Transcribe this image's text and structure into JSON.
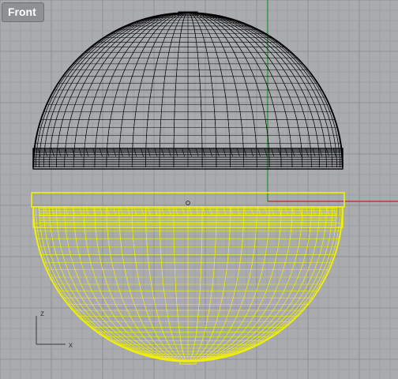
{
  "viewport": {
    "title": "Front",
    "axes": {
      "vertical_label": "z",
      "horizontal_label": "x"
    }
  },
  "colors": {
    "background": "#a9abae",
    "grid_minor": "#9d9fa2",
    "grid_major": "#8d8f92",
    "wireframe": "#000000",
    "selected_wireframe": "#f2f200",
    "world_y_axis": "#1f9a2e",
    "world_x_axis": "#c62020"
  }
}
